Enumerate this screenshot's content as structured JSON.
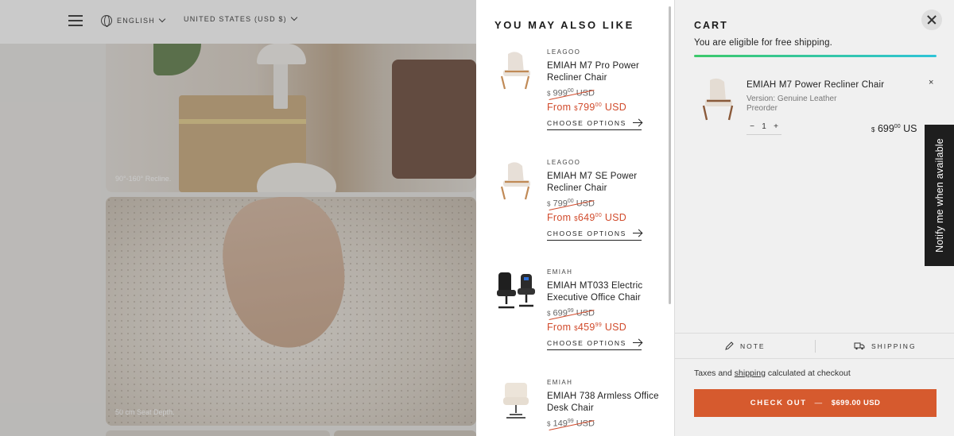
{
  "header": {
    "language": "ENGLISH",
    "currency": "UNITED STATES (USD $)"
  },
  "background": {
    "caption_1": "90°-160° Recline.",
    "caption_2": "50 cm Seat Depth."
  },
  "recommendations": {
    "title": "YOU MAY ALSO LIKE",
    "items": [
      {
        "vendor": "LEAGOO",
        "name": "EMIAH M7 Pro Power Recliner Chair",
        "compare_cur": "$",
        "compare_main": "999",
        "compare_cents": "00",
        "compare_unit": "USD",
        "prefix": "From",
        "sale_cur": "$",
        "sale_main": "799",
        "sale_cents": "00",
        "sale_unit": "USD",
        "cta": "CHOOSE OPTIONS"
      },
      {
        "vendor": "LEAGOO",
        "name": "EMIAH M7 SE Power Recliner Chair",
        "compare_cur": "$",
        "compare_main": "799",
        "compare_cents": "00",
        "compare_unit": "USD",
        "prefix": "From",
        "sale_cur": "$",
        "sale_main": "649",
        "sale_cents": "00",
        "sale_unit": "USD",
        "cta": "CHOOSE OPTIONS"
      },
      {
        "vendor": "EMIAH",
        "name": "EMIAH MT033 Electric Executive Office Chair",
        "compare_cur": "$",
        "compare_main": "699",
        "compare_cents": "99",
        "compare_unit": "USD",
        "prefix": "From",
        "sale_cur": "$",
        "sale_main": "459",
        "sale_cents": "99",
        "sale_unit": "USD",
        "cta": "CHOOSE OPTIONS"
      },
      {
        "vendor": "EMIAH",
        "name": "EMIAH 738 Armless Office Desk Chair",
        "compare_cur": "$",
        "compare_main": "149",
        "compare_cents": "99",
        "compare_unit": "USD"
      }
    ]
  },
  "cart": {
    "title": "CART",
    "free_shipping": "You are eligible for free shipping.",
    "progress": 1.0,
    "line": {
      "name": "EMIAH M7 Power Recliner Chair",
      "variant": "Version: Genuine Leather",
      "preorder": "Preorder",
      "remove": "×",
      "qty_minus": "−",
      "qty": "1",
      "qty_plus": "+",
      "price_cur": "$",
      "price_main": "699",
      "price_cents": "00",
      "price_unit": "US"
    },
    "notify_tab": "Notify me when available",
    "note_label": "NOTE",
    "shipping_label": "SHIPPING",
    "taxes_prefix": "Taxes and",
    "taxes_link": "shipping",
    "taxes_suffix": "calculated at checkout",
    "checkout_label": "CHECK OUT",
    "checkout_dash": "—",
    "checkout_total": "$699.00 USD"
  },
  "colors": {
    "accent": "#d65a2e",
    "sale": "#d14b2c",
    "progress_start": "#3cc86a",
    "progress_end": "#2ec4d8"
  }
}
